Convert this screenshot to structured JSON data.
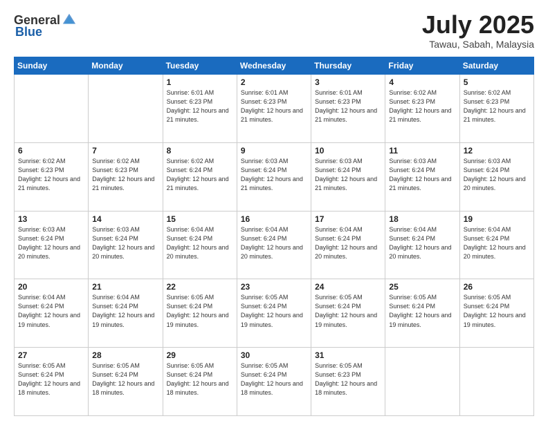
{
  "header": {
    "logo_general": "General",
    "logo_blue": "Blue",
    "month_year": "July 2025",
    "location": "Tawau, Sabah, Malaysia"
  },
  "weekdays": [
    "Sunday",
    "Monday",
    "Tuesday",
    "Wednesday",
    "Thursday",
    "Friday",
    "Saturday"
  ],
  "weeks": [
    [
      {
        "day": "",
        "sunrise": "",
        "sunset": "",
        "daylight": "",
        "empty": true
      },
      {
        "day": "",
        "sunrise": "",
        "sunset": "",
        "daylight": "",
        "empty": true
      },
      {
        "day": "1",
        "sunrise": "Sunrise: 6:01 AM",
        "sunset": "Sunset: 6:23 PM",
        "daylight": "Daylight: 12 hours and 21 minutes."
      },
      {
        "day": "2",
        "sunrise": "Sunrise: 6:01 AM",
        "sunset": "Sunset: 6:23 PM",
        "daylight": "Daylight: 12 hours and 21 minutes."
      },
      {
        "day": "3",
        "sunrise": "Sunrise: 6:01 AM",
        "sunset": "Sunset: 6:23 PM",
        "daylight": "Daylight: 12 hours and 21 minutes."
      },
      {
        "day": "4",
        "sunrise": "Sunrise: 6:02 AM",
        "sunset": "Sunset: 6:23 PM",
        "daylight": "Daylight: 12 hours and 21 minutes."
      },
      {
        "day": "5",
        "sunrise": "Sunrise: 6:02 AM",
        "sunset": "Sunset: 6:23 PM",
        "daylight": "Daylight: 12 hours and 21 minutes."
      }
    ],
    [
      {
        "day": "6",
        "sunrise": "Sunrise: 6:02 AM",
        "sunset": "Sunset: 6:23 PM",
        "daylight": "Daylight: 12 hours and 21 minutes."
      },
      {
        "day": "7",
        "sunrise": "Sunrise: 6:02 AM",
        "sunset": "Sunset: 6:23 PM",
        "daylight": "Daylight: 12 hours and 21 minutes."
      },
      {
        "day": "8",
        "sunrise": "Sunrise: 6:02 AM",
        "sunset": "Sunset: 6:24 PM",
        "daylight": "Daylight: 12 hours and 21 minutes."
      },
      {
        "day": "9",
        "sunrise": "Sunrise: 6:03 AM",
        "sunset": "Sunset: 6:24 PM",
        "daylight": "Daylight: 12 hours and 21 minutes."
      },
      {
        "day": "10",
        "sunrise": "Sunrise: 6:03 AM",
        "sunset": "Sunset: 6:24 PM",
        "daylight": "Daylight: 12 hours and 21 minutes."
      },
      {
        "day": "11",
        "sunrise": "Sunrise: 6:03 AM",
        "sunset": "Sunset: 6:24 PM",
        "daylight": "Daylight: 12 hours and 21 minutes."
      },
      {
        "day": "12",
        "sunrise": "Sunrise: 6:03 AM",
        "sunset": "Sunset: 6:24 PM",
        "daylight": "Daylight: 12 hours and 20 minutes."
      }
    ],
    [
      {
        "day": "13",
        "sunrise": "Sunrise: 6:03 AM",
        "sunset": "Sunset: 6:24 PM",
        "daylight": "Daylight: 12 hours and 20 minutes."
      },
      {
        "day": "14",
        "sunrise": "Sunrise: 6:03 AM",
        "sunset": "Sunset: 6:24 PM",
        "daylight": "Daylight: 12 hours and 20 minutes."
      },
      {
        "day": "15",
        "sunrise": "Sunrise: 6:04 AM",
        "sunset": "Sunset: 6:24 PM",
        "daylight": "Daylight: 12 hours and 20 minutes."
      },
      {
        "day": "16",
        "sunrise": "Sunrise: 6:04 AM",
        "sunset": "Sunset: 6:24 PM",
        "daylight": "Daylight: 12 hours and 20 minutes."
      },
      {
        "day": "17",
        "sunrise": "Sunrise: 6:04 AM",
        "sunset": "Sunset: 6:24 PM",
        "daylight": "Daylight: 12 hours and 20 minutes."
      },
      {
        "day": "18",
        "sunrise": "Sunrise: 6:04 AM",
        "sunset": "Sunset: 6:24 PM",
        "daylight": "Daylight: 12 hours and 20 minutes."
      },
      {
        "day": "19",
        "sunrise": "Sunrise: 6:04 AM",
        "sunset": "Sunset: 6:24 PM",
        "daylight": "Daylight: 12 hours and 20 minutes."
      }
    ],
    [
      {
        "day": "20",
        "sunrise": "Sunrise: 6:04 AM",
        "sunset": "Sunset: 6:24 PM",
        "daylight": "Daylight: 12 hours and 19 minutes."
      },
      {
        "day": "21",
        "sunrise": "Sunrise: 6:04 AM",
        "sunset": "Sunset: 6:24 PM",
        "daylight": "Daylight: 12 hours and 19 minutes."
      },
      {
        "day": "22",
        "sunrise": "Sunrise: 6:05 AM",
        "sunset": "Sunset: 6:24 PM",
        "daylight": "Daylight: 12 hours and 19 minutes."
      },
      {
        "day": "23",
        "sunrise": "Sunrise: 6:05 AM",
        "sunset": "Sunset: 6:24 PM",
        "daylight": "Daylight: 12 hours and 19 minutes."
      },
      {
        "day": "24",
        "sunrise": "Sunrise: 6:05 AM",
        "sunset": "Sunset: 6:24 PM",
        "daylight": "Daylight: 12 hours and 19 minutes."
      },
      {
        "day": "25",
        "sunrise": "Sunrise: 6:05 AM",
        "sunset": "Sunset: 6:24 PM",
        "daylight": "Daylight: 12 hours and 19 minutes."
      },
      {
        "day": "26",
        "sunrise": "Sunrise: 6:05 AM",
        "sunset": "Sunset: 6:24 PM",
        "daylight": "Daylight: 12 hours and 19 minutes."
      }
    ],
    [
      {
        "day": "27",
        "sunrise": "Sunrise: 6:05 AM",
        "sunset": "Sunset: 6:24 PM",
        "daylight": "Daylight: 12 hours and 18 minutes."
      },
      {
        "day": "28",
        "sunrise": "Sunrise: 6:05 AM",
        "sunset": "Sunset: 6:24 PM",
        "daylight": "Daylight: 12 hours and 18 minutes."
      },
      {
        "day": "29",
        "sunrise": "Sunrise: 6:05 AM",
        "sunset": "Sunset: 6:24 PM",
        "daylight": "Daylight: 12 hours and 18 minutes."
      },
      {
        "day": "30",
        "sunrise": "Sunrise: 6:05 AM",
        "sunset": "Sunset: 6:24 PM",
        "daylight": "Daylight: 12 hours and 18 minutes."
      },
      {
        "day": "31",
        "sunrise": "Sunrise: 6:05 AM",
        "sunset": "Sunset: 6:23 PM",
        "daylight": "Daylight: 12 hours and 18 minutes."
      },
      {
        "day": "",
        "sunrise": "",
        "sunset": "",
        "daylight": "",
        "empty": true
      },
      {
        "day": "",
        "sunrise": "",
        "sunset": "",
        "daylight": "",
        "empty": true
      }
    ]
  ]
}
